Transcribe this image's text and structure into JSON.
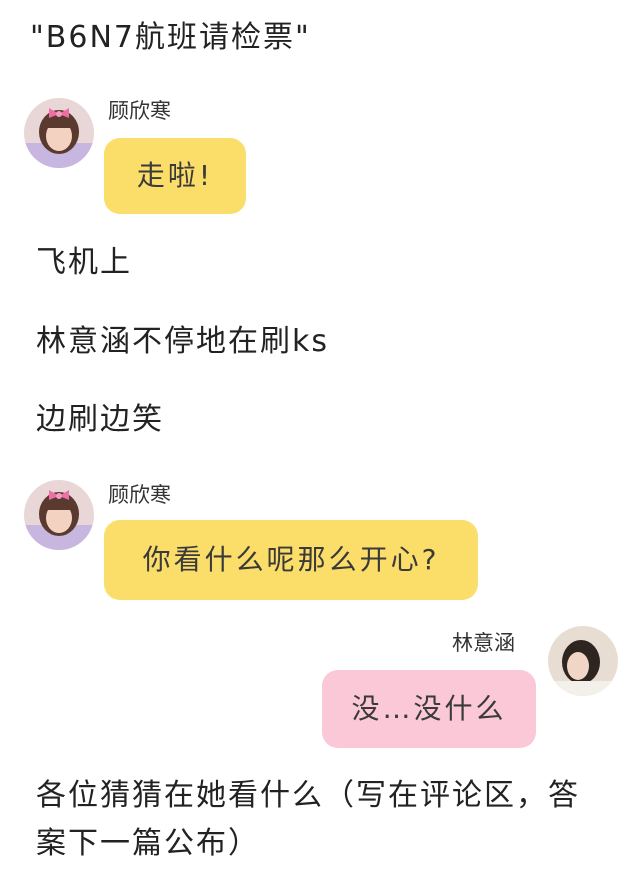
{
  "header": {
    "title": "\"B6N7航班请检票\""
  },
  "messages": [
    {
      "sender": "顾欣寒",
      "text": "走啦!",
      "color": "#fbdd6a"
    },
    {
      "sender": "顾欣寒",
      "text": "你看什么呢那么开心?",
      "color": "#fbdd6a"
    },
    {
      "sender": "林意涵",
      "text": "没…没什么",
      "color": "#fbc8d8"
    }
  ],
  "narration": {
    "line1": "飞机上",
    "line2": "林意涵不停地在刷ks",
    "line3": "边刷边笑",
    "closing": "各位猜猜在她看什么（写在评论区，答案下一篇公布）"
  },
  "avatars": {
    "left_icon": "girl-with-bow-avatar-icon",
    "right_icon": "girl-portrait-avatar-icon"
  }
}
